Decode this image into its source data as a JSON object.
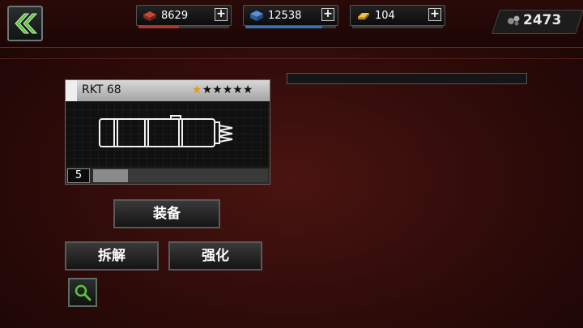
{
  "resources": [
    {
      "name": "brick",
      "icon": "brick-icon",
      "value": "8629",
      "color": "#a33a2a",
      "level": 0.45
    },
    {
      "name": "crate",
      "icon": "crate-icon",
      "value": "12538",
      "color": "#3b6fb0",
      "level": 0.85
    },
    {
      "name": "gold",
      "icon": "gold-icon",
      "value": "104",
      "color": "#d39a2a",
      "level": 0.0
    }
  ],
  "gems": {
    "icon": "gems-icon",
    "value": "2473"
  },
  "weapon": {
    "name": "RKT 68",
    "stars_filled": 1,
    "stars_total": 6,
    "level": "5",
    "level_progress": 0.2,
    "image": "rocket-launcher-icon"
  },
  "buttons": {
    "equip": "装备",
    "dismantle": "拆解",
    "upgrade": "强化"
  },
  "colors": {
    "accent": "#5ac43c",
    "star": "#e39b12"
  }
}
